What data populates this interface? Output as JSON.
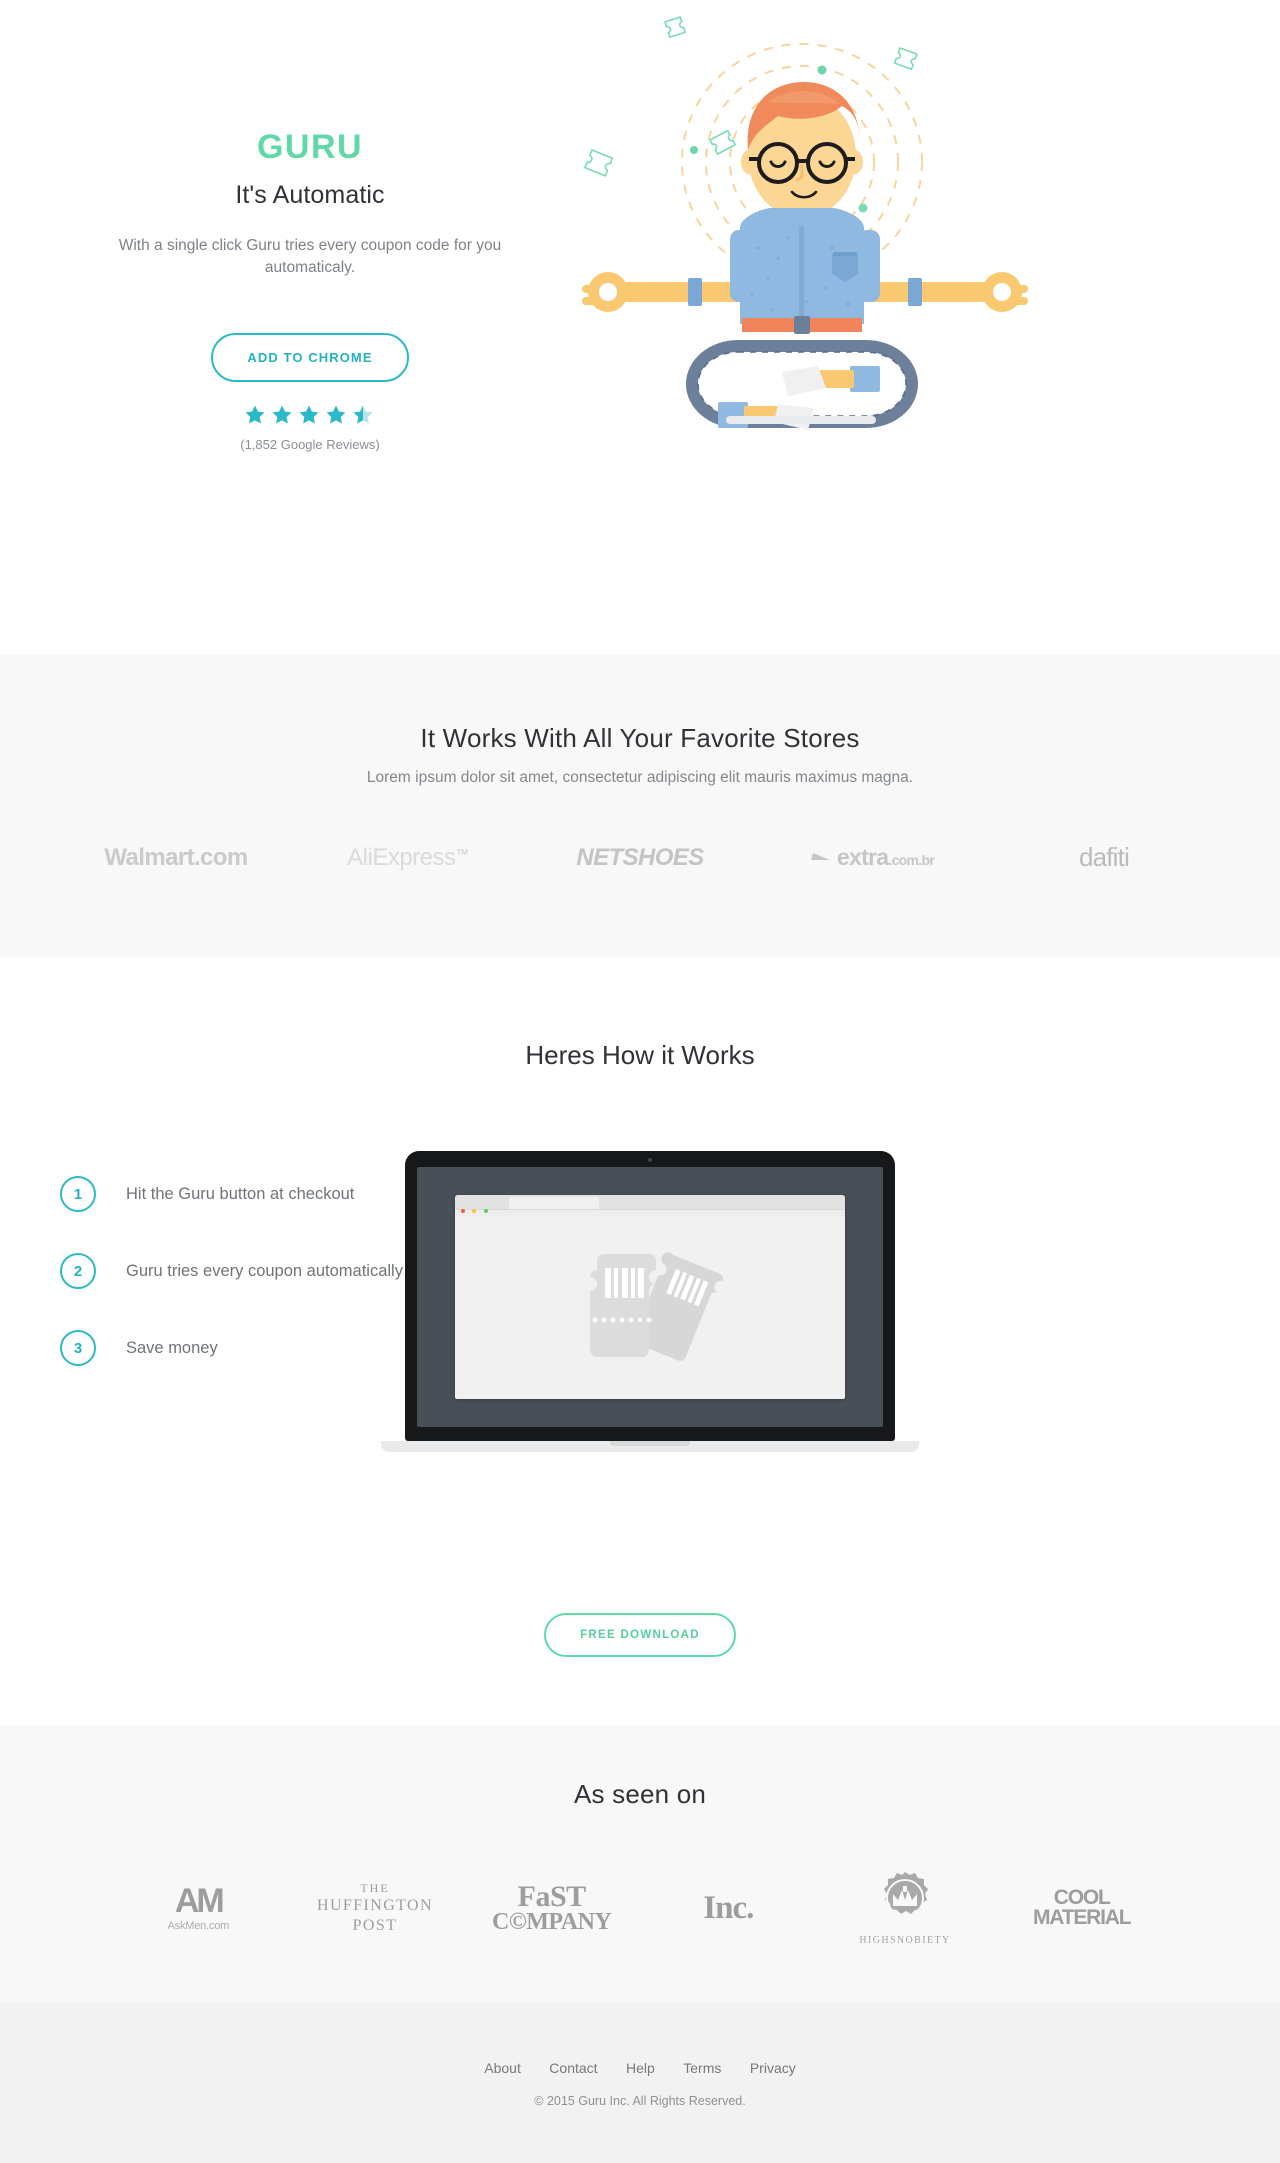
{
  "hero": {
    "brand": "GURU",
    "tagline": "It's Automatic",
    "subcopy": "With a single click Guru tries every coupon code for you automaticaly.",
    "cta_label": "ADD TO CHROME",
    "rating": 4.5,
    "rating_max": 5,
    "reviews_text": "(1,852 Google Reviews)",
    "star_color": "#2bb9c7",
    "brand_color": "#5fd9a6",
    "accent_color": "#23b2c0"
  },
  "stores": {
    "title": "It Works With All Your Favorite Stores",
    "subtitle": "Lorem ipsum dolor sit amet, consectetur adipiscing elit mauris maximus magna.",
    "logos": [
      {
        "name": "walmart",
        "text": "Walmart.com"
      },
      {
        "name": "aliexpress",
        "text": "AliExpress"
      },
      {
        "name": "netshoes",
        "text": "NETSHOES"
      },
      {
        "name": "extra",
        "text": "extra",
        "tld": ".com.br"
      },
      {
        "name": "dafiti",
        "text": "dafiti"
      }
    ]
  },
  "how": {
    "title": "Heres How it Works",
    "steps": [
      {
        "number": "1",
        "text": "Hit the Guru button at checkout"
      },
      {
        "number": "2",
        "text": "Guru tries every coupon automatically"
      },
      {
        "number": "3",
        "text": "Save money"
      }
    ],
    "cta_label": "FREE DOWNLOAD",
    "cta_color": "#5fd9a6"
  },
  "seen": {
    "title": "As seen on",
    "logos": [
      {
        "name": "askmen",
        "mark": "AM",
        "text": "AskMen.com"
      },
      {
        "name": "huffington-post",
        "l1": "THE",
        "l2": "HUFFINGTON",
        "l3": "POST"
      },
      {
        "name": "fast-company",
        "l1": "FaST",
        "l2": "C©MPANY"
      },
      {
        "name": "inc",
        "text": "Inc."
      },
      {
        "name": "highsnobiety",
        "text": "HIGHSNOBIETY"
      },
      {
        "name": "cool-material",
        "l1": "COOL",
        "l2": "MATERIAL"
      }
    ]
  },
  "footer": {
    "links": [
      {
        "label": "About"
      },
      {
        "label": "Contact"
      },
      {
        "label": "Help"
      },
      {
        "label": "Terms"
      },
      {
        "label": "Privacy"
      }
    ],
    "copyright": "© 2015 Guru Inc. All Rights Reserved."
  }
}
